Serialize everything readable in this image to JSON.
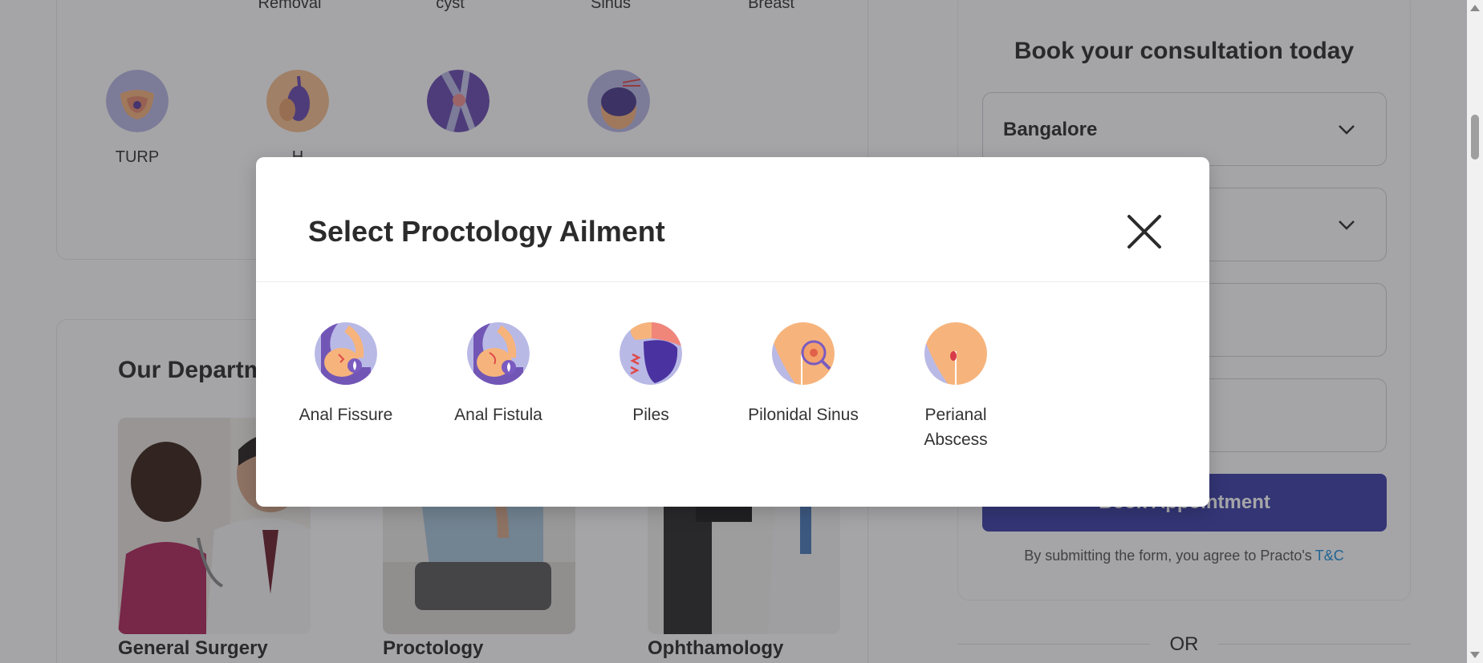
{
  "top_row_labels": [
    "Removal",
    "cyst",
    "Sinus",
    "Breast"
  ],
  "surgeries": [
    {
      "label": "TURP",
      "icon": "prostate-icon"
    },
    {
      "label": "H",
      "icon": "hernia-icon"
    },
    {
      "label": "",
      "icon": "knee-icon"
    },
    {
      "label": "",
      "icon": "hair-transplant-icon"
    }
  ],
  "departments": {
    "title": "Our Departm",
    "items": [
      {
        "name": "General Surgery"
      },
      {
        "name": "Proctology"
      },
      {
        "name": "Ophthamology"
      }
    ]
  },
  "consultation_form": {
    "title": "Book your consultation today",
    "city_value": "Bangalore",
    "book_button": "Book Appointment",
    "terms_text": "By submitting the form, you agree to Practo's",
    "terms_link": "T&C",
    "or_text": "OR"
  },
  "modal": {
    "title": "Select Proctology Ailment",
    "ailments": [
      {
        "label": "Anal Fissure",
        "icon": "anal-fissure-icon"
      },
      {
        "label": "Anal Fistula",
        "icon": "anal-fistula-icon"
      },
      {
        "label": "Piles",
        "icon": "piles-icon"
      },
      {
        "label": "Pilonidal Sinus",
        "icon": "pilonidal-sinus-icon"
      },
      {
        "label": "Perianal Abscess",
        "icon": "perianal-abscess-icon"
      }
    ]
  },
  "colors": {
    "primary_button": "#3b3fa8",
    "link": "#1a8fd8",
    "overlay": "rgba(40,40,48,0.42)",
    "icon_lavender": "#b9b9e6",
    "icon_peach": "#f6b47c"
  }
}
